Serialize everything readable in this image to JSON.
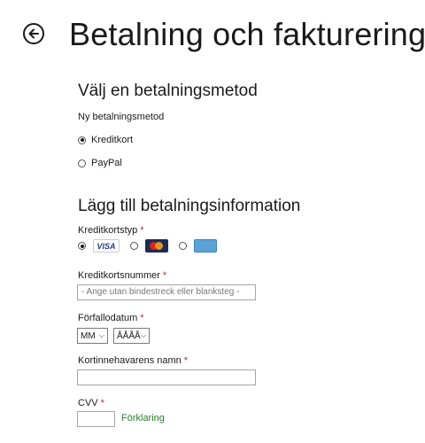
{
  "header": {
    "title": "Betalning och fakturering",
    "back_icon": "back-arrow-icon"
  },
  "payment_method": {
    "section_title": "Välj en betalningsmetod",
    "label": "Ny betalningsmetod",
    "options": [
      {
        "label": "Kreditkort",
        "selected": true
      },
      {
        "label": "PayPal",
        "selected": false
      }
    ]
  },
  "payment_info": {
    "section_title": "Lägg till betalningsinformation",
    "card_type_label": "Kreditkortstyp",
    "card_types": [
      {
        "name": "VISA",
        "icon": "visa-card-icon",
        "selected": true
      },
      {
        "name": "MasterCard",
        "icon": "mastercard-icon",
        "selected": false
      },
      {
        "name": "AMERICAN EXPRESS",
        "icon": "amex-card-icon",
        "selected": false
      }
    ],
    "card_number_label": "Kreditkortsnummer",
    "card_number_placeholder": "- Ange utan bindestreck eller blanksteg -",
    "expiry_label": "Förfallodatum",
    "expiry_month": "MM",
    "expiry_year": "ÅÅÅÅ",
    "holder_label": "Kortinnehavarens namn",
    "holder_value": "",
    "cvv_label": "CVV",
    "cvv_value": "",
    "cvv_link": "Förklaring",
    "required_marker": "*"
  },
  "colors": {
    "required": "#c8242b",
    "link": "#2a7d2a",
    "text": "#1a1a1a"
  }
}
